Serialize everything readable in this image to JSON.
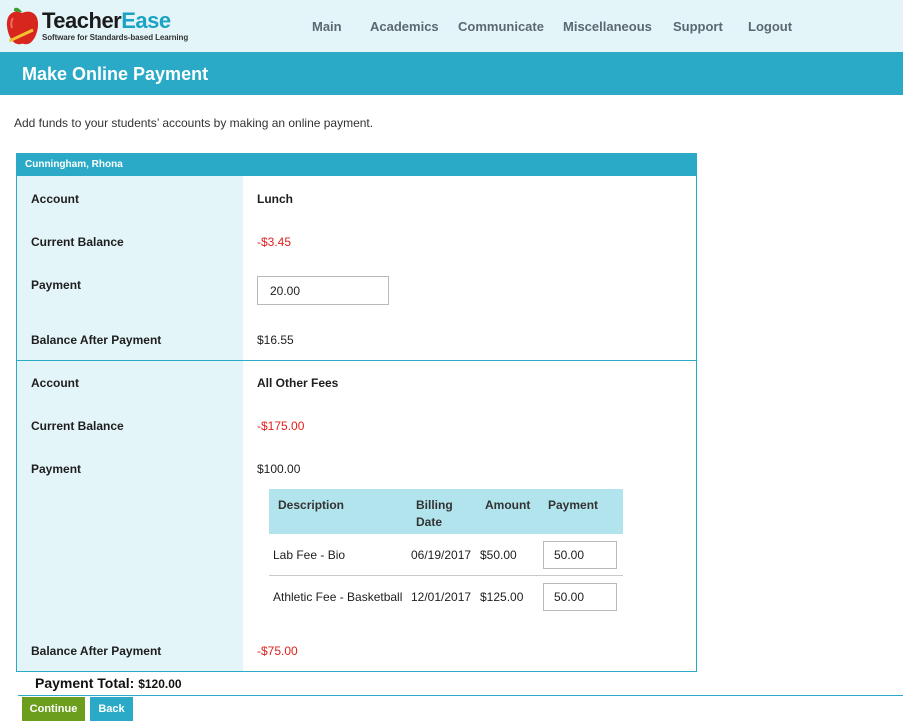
{
  "app": {
    "logo_name_part1": "Teacher",
    "logo_name_part2": "Ease",
    "logo_tagline": "Software for Standards-based Learning"
  },
  "nav": {
    "items": [
      "Main",
      "Academics",
      "Communicate",
      "Miscellaneous",
      "Support",
      "Logout"
    ]
  },
  "page": {
    "title": "Make Online Payment",
    "intro": "Add funds to your students’ accounts by making an online payment."
  },
  "student": {
    "name": "Cunningham, Rhona",
    "lunch": {
      "account_label": "Account",
      "account": "Lunch",
      "balance_label": "Current Balance",
      "balance": "-$3.45",
      "payment_label": "Payment",
      "payment": "20.00",
      "after_label": "Balance After Payment",
      "after": "$16.55"
    },
    "fees": {
      "account_label": "Account",
      "account": "All Other Fees",
      "balance_label": "Current Balance",
      "balance": "-$175.00",
      "payment_label": "Payment",
      "payment": "$100.00",
      "after_label": "Balance After Payment",
      "after": "-$75.00",
      "table": {
        "headers": {
          "description": "Description",
          "billing_date_1": "Billing",
          "billing_date_2": "Date",
          "amount": "Amount",
          "payment": "Payment"
        },
        "rows": [
          {
            "description": "Lab Fee - Bio",
            "date": "06/19/2017",
            "amount": "$50.00",
            "payment": "50.00"
          },
          {
            "description": "Athletic Fee - Basketball",
            "date": "12/01/2017",
            "amount": "$125.00",
            "payment": "50.00"
          }
        ]
      }
    }
  },
  "total": {
    "label": "Payment Total:",
    "amount": "$120.00"
  },
  "buttons": {
    "continue": "Continue",
    "back": "Back"
  },
  "colors": {
    "accent": "#2aaac6",
    "header_bg": "#e4f5f9",
    "negative": "#e0201c",
    "continue": "#6c9e1d"
  }
}
